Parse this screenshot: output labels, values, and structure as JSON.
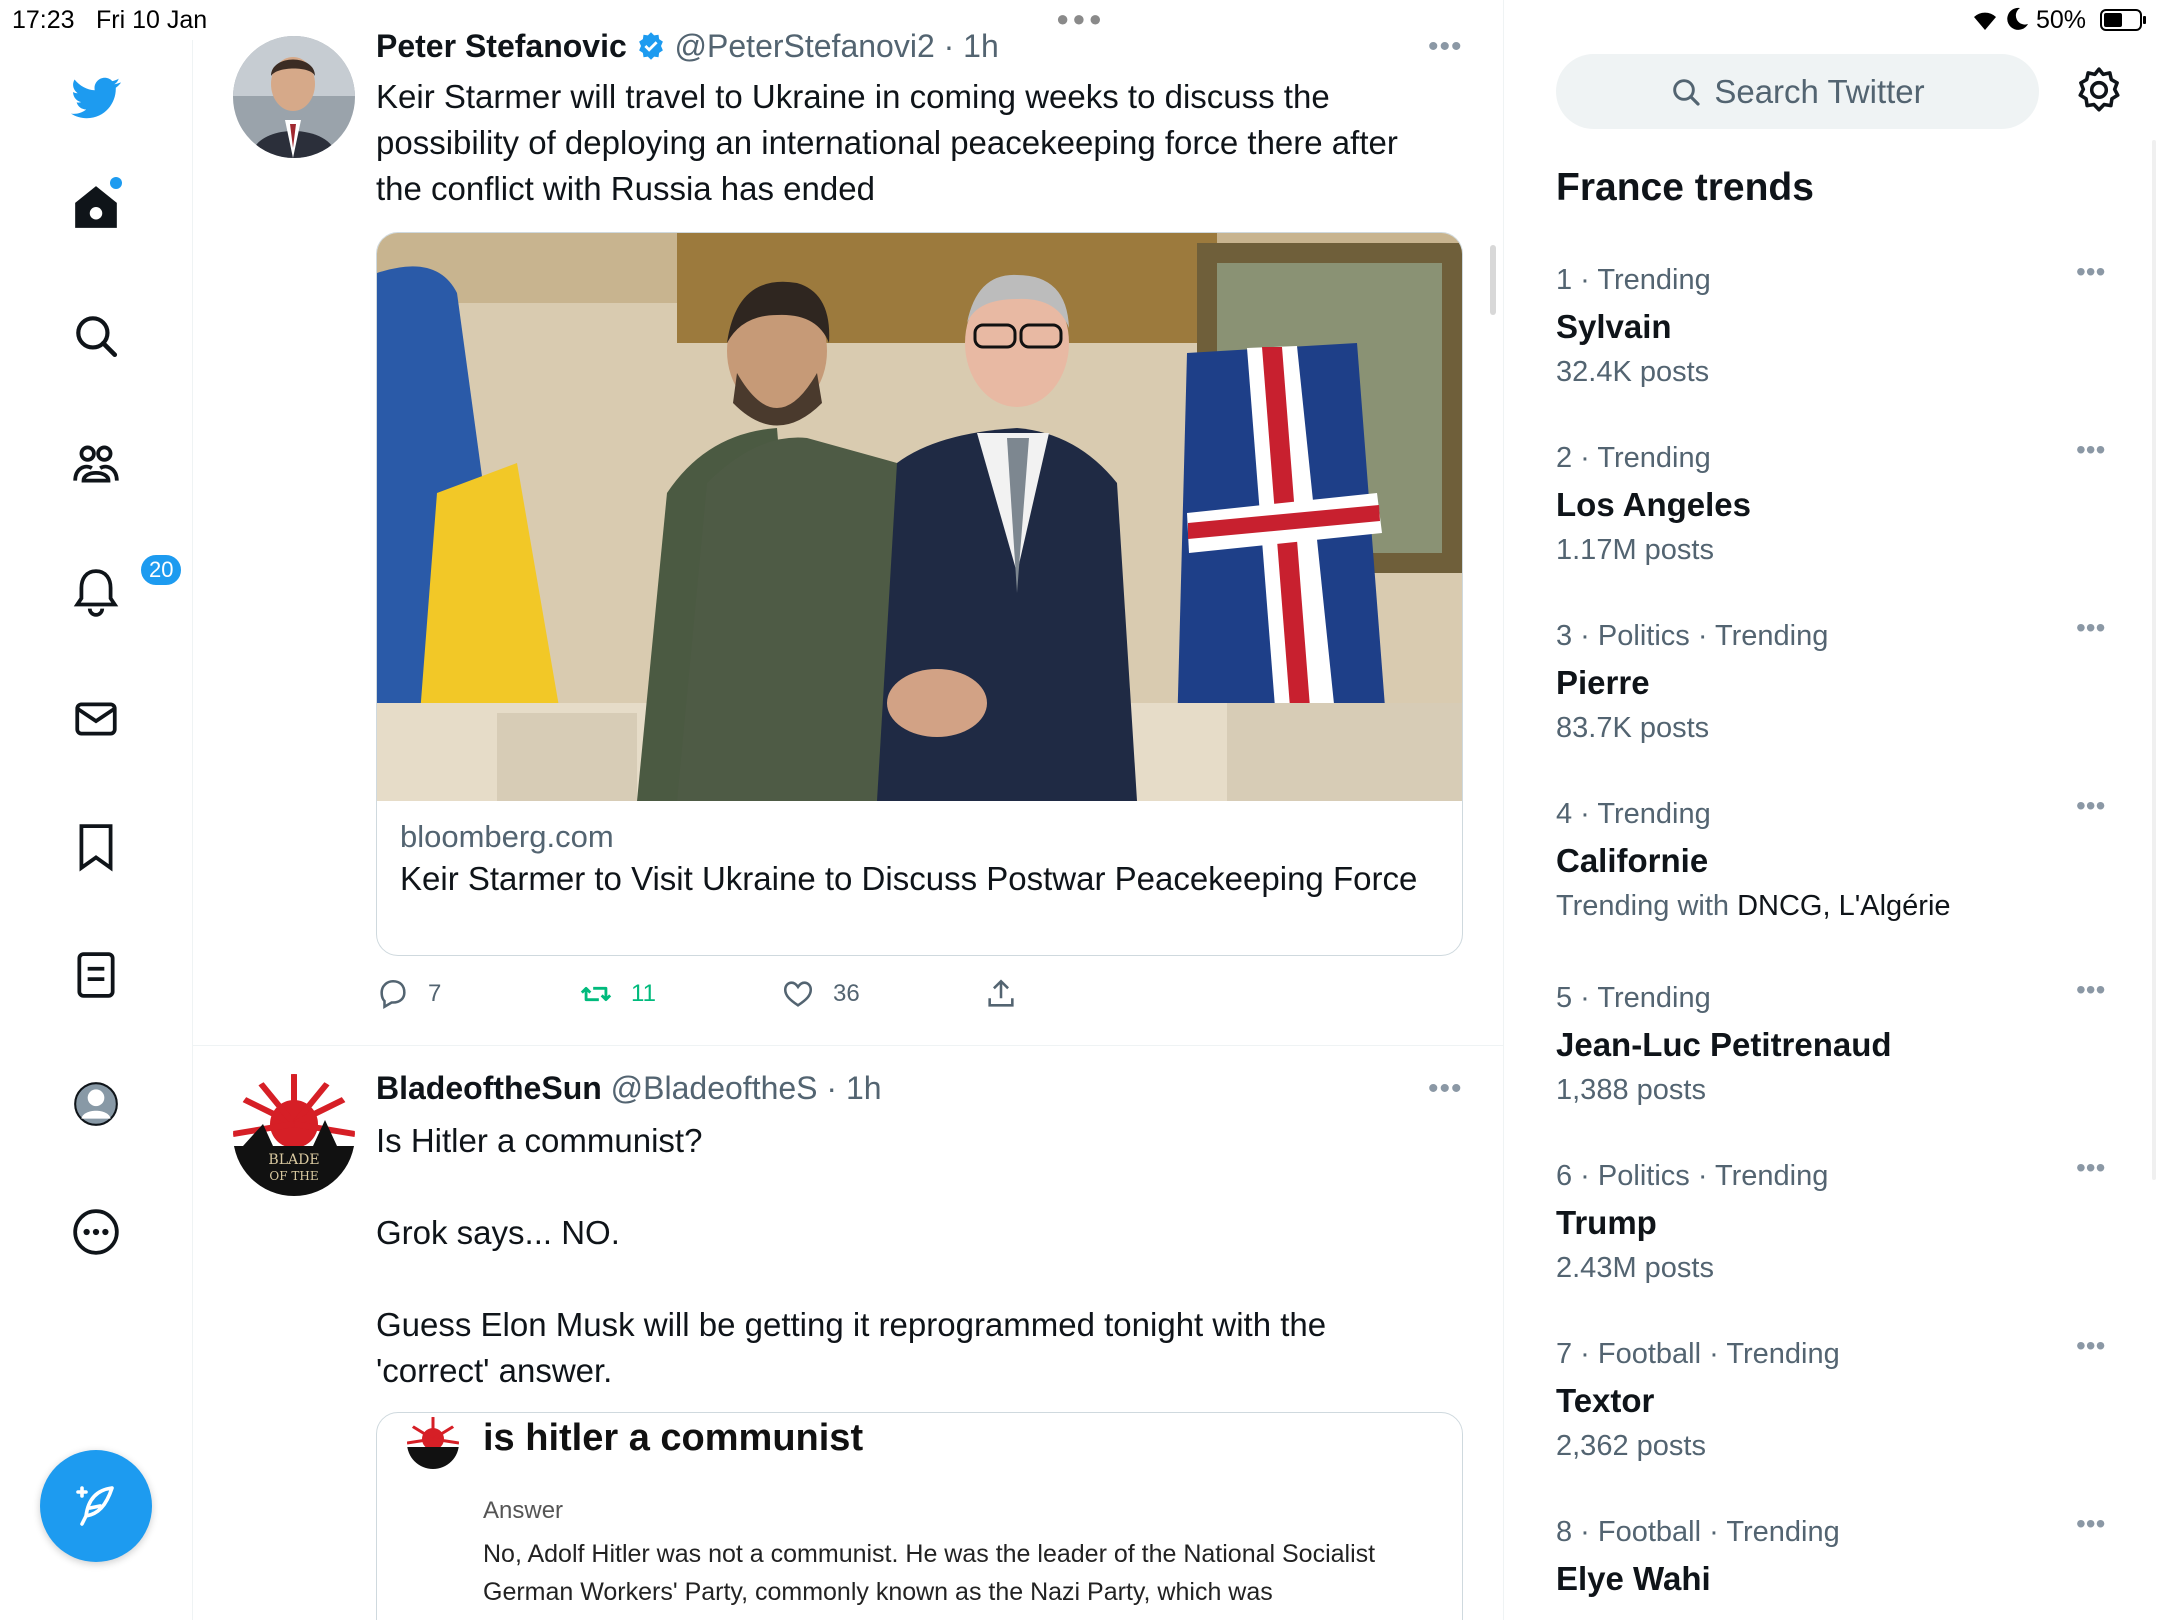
{
  "status_bar": {
    "time": "17:23",
    "date": "Fri 10 Jan",
    "battery": "50%"
  },
  "nav": {
    "notifications_badge": "20"
  },
  "tweets": [
    {
      "name": "Peter Stefanovic",
      "handle": "@PeterStefanovi2",
      "time": "1h",
      "text": "Keir Starmer will travel to Ukraine in coming weeks to discuss the possibility of deploying an international peacekeeping force there after the conflict with Russia has ended",
      "card": {
        "domain": "bloomberg.com",
        "title": "Keir Starmer to Visit Ukraine to Discuss Postwar Peacekeeping Force"
      },
      "replies": "7",
      "retweets": "11",
      "likes": "36"
    },
    {
      "name": "BladeoftheSun",
      "handle": "@BladeoftheS",
      "time": "1h",
      "text": "Is Hitler a communist?\n\nGrok says... NO.\n\nGuess Elon Musk will be getting it reprogrammed tonight with the 'correct' answer.",
      "embed": {
        "query": "is hitler a communist",
        "answer_label": "Answer",
        "answer_text": "No, Adolf Hitler was not a communist. He was the leader of the National Socialist German Workers' Party, commonly known as the Nazi Party, which was fundamentally opposed to communism. Hitler's beliefs led..."
      }
    }
  ],
  "sidebar": {
    "search_placeholder": "Search Twitter",
    "trends_title": "France trends",
    "trends": [
      {
        "meta": "1 · Trending",
        "name": "Sylvain",
        "count": "32.4K posts"
      },
      {
        "meta": "2 · Trending",
        "name": "Los Angeles",
        "count": "1.17M posts"
      },
      {
        "meta": "3 · Politics · Trending",
        "name": "Pierre",
        "count": "83.7K posts"
      },
      {
        "meta": "4 · Trending",
        "name": "Californie",
        "count_prefix": "Trending with ",
        "count_highlight": "DNCG, L'Algérie"
      },
      {
        "meta": "5 · Trending",
        "name": "Jean-Luc Petitrenaud",
        "count": "1,388 posts"
      },
      {
        "meta": "6 · Politics · Trending",
        "name": "Trump",
        "count": "2.43M posts"
      },
      {
        "meta": "7 · Football · Trending",
        "name": "Textor",
        "count": "2,362 posts"
      },
      {
        "meta": "8 · Football · Trending",
        "name": "Elye Wahi",
        "count": ""
      }
    ]
  },
  "colors": {
    "accent": "#1d9bf0",
    "retweet_green": "#00ba7c",
    "secondary_text": "#536471"
  }
}
